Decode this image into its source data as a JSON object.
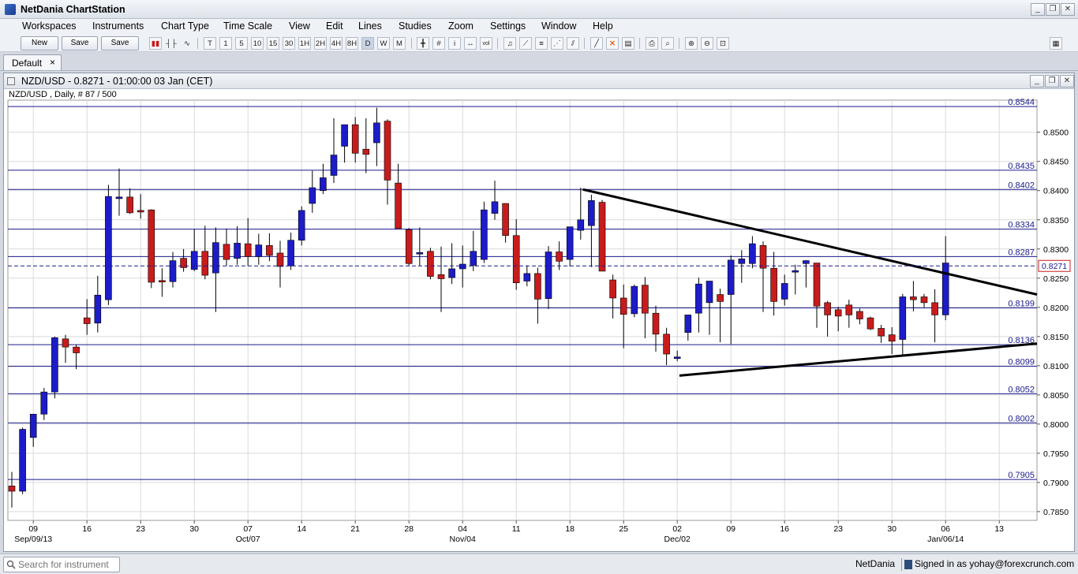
{
  "window": {
    "title": "NetDania ChartStation",
    "controls": [
      "_",
      "❐",
      "✕"
    ]
  },
  "menu": [
    "Workspaces",
    "Instruments",
    "Chart Type",
    "Time Scale",
    "View",
    "Edit",
    "Lines",
    "Studies",
    "Zoom",
    "Settings",
    "Window",
    "Help"
  ],
  "toolbar": {
    "new_label": "New",
    "save_label": "Save",
    "save_as_label": "Save as...",
    "timescales": [
      "T",
      "1",
      "5",
      "10",
      "15",
      "30",
      "1H",
      "2H",
      "4H",
      "8H",
      "D",
      "W",
      "M"
    ],
    "selected_timescale": "D"
  },
  "tabs": [
    {
      "label": "Default",
      "close": "×"
    }
  ],
  "chart": {
    "title": "NZD/USD - 0.8271 - 01:00:00  03 Jan (CET)",
    "subtitle": "NZD/USD , Daily, # 87 / 500",
    "current_price": "0.8271",
    "colors": {
      "up": "#1c1cc8",
      "down": "#c81c1c",
      "level_line": "#1a1a8c",
      "trend": "#000000",
      "grid": "#d9d9d9"
    }
  },
  "chart_data": {
    "type": "candlestick",
    "instrument": "NZD/USD",
    "timeframe": "Daily",
    "ylim": [
      0.7835,
      0.8555
    ],
    "y_ticks": [
      "0.8500",
      "0.8450",
      "0.8400",
      "0.8350",
      "0.8300",
      "0.8250",
      "0.8200",
      "0.8150",
      "0.8100",
      "0.8050",
      "0.8000",
      "0.7950",
      "0.7900",
      "0.7850"
    ],
    "x_ticks": [
      "09",
      "16",
      "23",
      "30",
      "07",
      "14",
      "21",
      "28",
      "04",
      "11",
      "18",
      "25",
      "02",
      "09",
      "16",
      "23",
      "30",
      "06",
      "13"
    ],
    "x_month_labels": [
      "Sep/09/13",
      "Oct/07",
      "Nov/04",
      "Dec/02",
      "Jan/06/14"
    ],
    "levels": [
      "0.8544",
      "0.8435",
      "0.8402",
      "0.8334",
      "0.8287",
      "0.8199",
      "0.8136",
      "0.8099",
      "0.8052",
      "0.8002",
      "0.7905"
    ],
    "trendlines": [
      {
        "from": [
          0.8402,
          18
        ],
        "to": [
          0.8222,
          58.5
        ]
      },
      {
        "from": [
          0.8083,
          20.5
        ],
        "to": [
          0.8138,
          58.5
        ]
      }
    ],
    "candles": [
      [
        0.7894,
        0.7918,
        0.7857,
        0.7885
      ],
      [
        0.7885,
        0.7994,
        0.788,
        0.7991
      ],
      [
        0.7977,
        0.8017,
        0.7961,
        0.8017
      ],
      [
        0.8017,
        0.8062,
        0.8007,
        0.8055
      ],
      [
        0.8055,
        0.815,
        0.8044,
        0.8148
      ],
      [
        0.8146,
        0.8153,
        0.8105,
        0.8132
      ],
      [
        0.8132,
        0.8136,
        0.8094,
        0.8122
      ],
      [
        0.8182,
        0.8214,
        0.8153,
        0.8172
      ],
      [
        0.8173,
        0.8254,
        0.8157,
        0.8221
      ],
      [
        0.8213,
        0.841,
        0.8204,
        0.839
      ],
      [
        0.8389,
        0.8438,
        0.8357,
        0.8389
      ],
      [
        0.8389,
        0.8404,
        0.836,
        0.8362
      ],
      [
        0.8366,
        0.8394,
        0.8352,
        0.8364
      ],
      [
        0.8367,
        0.8368,
        0.8233,
        0.8243
      ],
      [
        0.8246,
        0.8267,
        0.8218,
        0.8245
      ],
      [
        0.8244,
        0.8295,
        0.8234,
        0.828
      ],
      [
        0.8284,
        0.83,
        0.8261,
        0.8268
      ],
      [
        0.8265,
        0.8334,
        0.8262,
        0.8296
      ],
      [
        0.8296,
        0.834,
        0.8248,
        0.8255
      ],
      [
        0.8259,
        0.8337,
        0.8192,
        0.8311
      ],
      [
        0.8308,
        0.8335,
        0.8271,
        0.8282
      ],
      [
        0.8284,
        0.8339,
        0.8273,
        0.831
      ],
      [
        0.8309,
        0.8353,
        0.8271,
        0.8287
      ],
      [
        0.8287,
        0.8326,
        0.8273,
        0.8307
      ],
      [
        0.8306,
        0.8327,
        0.8279,
        0.8289
      ],
      [
        0.8293,
        0.8314,
        0.8234,
        0.827
      ],
      [
        0.8271,
        0.8328,
        0.8264,
        0.8315
      ],
      [
        0.8315,
        0.8373,
        0.8306,
        0.8366
      ],
      [
        0.8378,
        0.8434,
        0.8362,
        0.8405
      ],
      [
        0.84,
        0.8446,
        0.8394,
        0.8422
      ],
      [
        0.8426,
        0.8524,
        0.8413,
        0.8461
      ],
      [
        0.8476,
        0.8512,
        0.8448,
        0.8513
      ],
      [
        0.8513,
        0.8526,
        0.8448,
        0.8464
      ],
      [
        0.8471,
        0.8524,
        0.843,
        0.8462
      ],
      [
        0.8482,
        0.8542,
        0.8442,
        0.8516
      ],
      [
        0.8519,
        0.8522,
        0.8376,
        0.8418
      ],
      [
        0.8413,
        0.8446,
        0.8336,
        0.8335
      ],
      [
        0.8333,
        0.8336,
        0.8272,
        0.8275
      ],
      [
        0.8294,
        0.8337,
        0.8271,
        0.8294
      ],
      [
        0.8296,
        0.8302,
        0.8248,
        0.8253
      ],
      [
        0.8256,
        0.8304,
        0.8192,
        0.8249
      ],
      [
        0.8251,
        0.831,
        0.824,
        0.8266
      ],
      [
        0.8266,
        0.8306,
        0.8234,
        0.8274
      ],
      [
        0.8272,
        0.8331,
        0.8262,
        0.8296
      ],
      [
        0.8282,
        0.8381,
        0.8276,
        0.8367
      ],
      [
        0.8361,
        0.8417,
        0.835,
        0.8381
      ],
      [
        0.8378,
        0.8378,
        0.8311,
        0.8323
      ],
      [
        0.8323,
        0.8351,
        0.823,
        0.8242
      ],
      [
        0.8245,
        0.8272,
        0.8236,
        0.8258
      ],
      [
        0.8258,
        0.8268,
        0.8172,
        0.8214
      ],
      [
        0.8215,
        0.8305,
        0.8197,
        0.8295
      ],
      [
        0.8295,
        0.8313,
        0.8264,
        0.8279
      ],
      [
        0.8282,
        0.8333,
        0.827,
        0.8338
      ],
      [
        0.8332,
        0.8405,
        0.8316,
        0.835
      ],
      [
        0.834,
        0.8393,
        0.8269,
        0.8383
      ],
      [
        0.838,
        0.8384,
        0.8262,
        0.8262
      ],
      [
        0.8247,
        0.8256,
        0.8181,
        0.8216
      ],
      [
        0.8216,
        0.8239,
        0.813,
        0.8188
      ],
      [
        0.8189,
        0.8239,
        0.8183,
        0.8236
      ],
      [
        0.8238,
        0.8252,
        0.8147,
        0.819
      ],
      [
        0.819,
        0.8203,
        0.8124,
        0.8154
      ],
      [
        0.8154,
        0.8165,
        0.8101,
        0.812
      ],
      [
        0.8115,
        0.8126,
        0.8108,
        0.8115
      ],
      [
        0.8157,
        0.8173,
        0.8143,
        0.8187
      ],
      [
        0.819,
        0.8251,
        0.8157,
        0.824
      ],
      [
        0.8208,
        0.8241,
        0.8153,
        0.8245
      ],
      [
        0.8222,
        0.8232,
        0.814,
        0.821
      ],
      [
        0.8222,
        0.8289,
        0.8137,
        0.8281
      ],
      [
        0.8275,
        0.8298,
        0.8242,
        0.8283
      ],
      [
        0.8275,
        0.8322,
        0.8267,
        0.8309
      ],
      [
        0.8306,
        0.8313,
        0.8192,
        0.8267
      ],
      [
        0.8267,
        0.8295,
        0.8186,
        0.821
      ],
      [
        0.8214,
        0.8256,
        0.8203,
        0.8241
      ],
      [
        0.8261,
        0.8273,
        0.8222,
        0.8263
      ],
      [
        0.8275,
        0.8281,
        0.8234,
        0.828
      ],
      [
        0.8276,
        0.8276,
        0.8165,
        0.8202
      ],
      [
        0.8208,
        0.8211,
        0.815,
        0.8187
      ],
      [
        0.8196,
        0.8201,
        0.8159,
        0.8185
      ],
      [
        0.8204,
        0.8213,
        0.8165,
        0.8187
      ],
      [
        0.8193,
        0.8198,
        0.8171,
        0.818
      ],
      [
        0.8182,
        0.8184,
        0.8161,
        0.8163
      ],
      [
        0.8164,
        0.817,
        0.8139,
        0.8151
      ],
      [
        0.8153,
        0.8166,
        0.812,
        0.8142
      ],
      [
        0.8145,
        0.8223,
        0.8117,
        0.8218
      ],
      [
        0.8218,
        0.8245,
        0.8193,
        0.8213
      ],
      [
        0.8218,
        0.8223,
        0.82,
        0.8208
      ],
      [
        0.8208,
        0.8231,
        0.814,
        0.8187
      ],
      [
        0.8187,
        0.8322,
        0.8178,
        0.8276
      ]
    ]
  },
  "status": {
    "search_placeholder": "Search for instrument",
    "brand": "NetDania",
    "signed_in": "Signed in as yohay@forexcrunch.com"
  }
}
